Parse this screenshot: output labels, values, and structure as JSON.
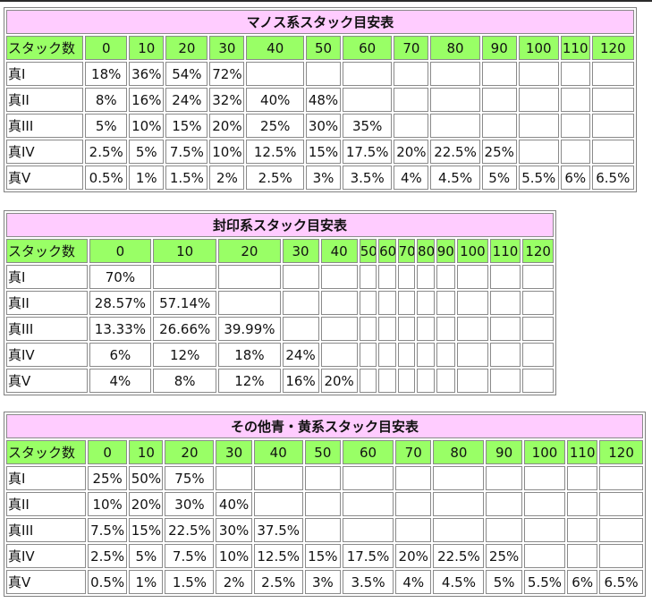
{
  "tables": [
    {
      "title": "マノス系スタック目安表",
      "headers": [
        "スタック数",
        "0",
        "10",
        "20",
        "30",
        "40",
        "50",
        "60",
        "70",
        "80",
        "90",
        "100",
        "110",
        "120"
      ],
      "rows": [
        {
          "label": "真I",
          "cells": [
            "18%",
            "36%",
            "54%",
            "72%",
            "",
            "",
            "",
            "",
            "",
            "",
            "",
            "",
            ""
          ]
        },
        {
          "label": "真II",
          "cells": [
            "8%",
            "16%",
            "24%",
            "32%",
            "40%",
            "48%",
            "",
            "",
            "",
            "",
            "",
            "",
            ""
          ]
        },
        {
          "label": "真III",
          "cells": [
            "5%",
            "10%",
            "15%",
            "20%",
            "25%",
            "30%",
            "35%",
            "",
            "",
            "",
            "",
            "",
            ""
          ]
        },
        {
          "label": "真IV",
          "cells": [
            "2.5%",
            "5%",
            "7.5%",
            "10%",
            "12.5%",
            "15%",
            "17.5%",
            "20%",
            "22.5%",
            "25%",
            "",
            "",
            ""
          ]
        },
        {
          "label": "真V",
          "cells": [
            "0.5%",
            "1%",
            "1.5%",
            "2%",
            "2.5%",
            "3%",
            "3.5%",
            "4%",
            "4.5%",
            "5%",
            "5.5%",
            "6%",
            "6.5%"
          ]
        }
      ]
    },
    {
      "title": "封印系スタック目安表",
      "headers": [
        "スタック数",
        "0",
        "10",
        "20",
        "30",
        "40",
        "50",
        "60",
        "70",
        "80",
        "90",
        "100",
        "110",
        "120"
      ],
      "rows": [
        {
          "label": "真I",
          "cells": [
            "70%",
            "",
            "",
            "",
            "",
            "",
            "",
            "",
            "",
            "",
            "",
            "",
            ""
          ]
        },
        {
          "label": "真II",
          "cells": [
            "28.57%",
            "57.14%",
            "",
            "",
            "",
            "",
            "",
            "",
            "",
            "",
            "",
            "",
            ""
          ]
        },
        {
          "label": "真III",
          "cells": [
            "13.33%",
            "26.66%",
            "39.99%",
            "",
            "",
            "",
            "",
            "",
            "",
            "",
            "",
            "",
            ""
          ]
        },
        {
          "label": "真IV",
          "cells": [
            "6%",
            "12%",
            "18%",
            "24%",
            "",
            "",
            "",
            "",
            "",
            "",
            "",
            "",
            ""
          ]
        },
        {
          "label": "真V",
          "cells": [
            "4%",
            "8%",
            "12%",
            "16%",
            "20%",
            "",
            "",
            "",
            "",
            "",
            "",
            "",
            ""
          ]
        }
      ]
    },
    {
      "title": "その他青・黄系スタック目安表",
      "headers": [
        "スタック数",
        "0",
        "10",
        "20",
        "30",
        "40",
        "50",
        "60",
        "70",
        "80",
        "90",
        "100",
        "110",
        "120"
      ],
      "rows": [
        {
          "label": "真I",
          "cells": [
            "25%",
            "50%",
            "75%",
            "",
            "",
            "",
            "",
            "",
            "",
            "",
            "",
            "",
            ""
          ]
        },
        {
          "label": "真II",
          "cells": [
            "10%",
            "20%",
            "30%",
            "40%",
            "",
            "",
            "",
            "",
            "",
            "",
            "",
            "",
            ""
          ]
        },
        {
          "label": "真III",
          "cells": [
            "7.5%",
            "15%",
            "22.5%",
            "30%",
            "37.5%",
            "",
            "",
            "",
            "",
            "",
            "",
            "",
            ""
          ]
        },
        {
          "label": "真IV",
          "cells": [
            "2.5%",
            "5%",
            "7.5%",
            "10%",
            "12.5%",
            "15%",
            "17.5%",
            "20%",
            "22.5%",
            "25%",
            "",
            "",
            ""
          ]
        },
        {
          "label": "真V",
          "cells": [
            "0.5%",
            "1%",
            "1.5%",
            "2%",
            "2.5%",
            "3%",
            "3.5%",
            "4%",
            "4.5%",
            "5%",
            "5.5%",
            "6%",
            "6.5%"
          ]
        }
      ]
    }
  ]
}
